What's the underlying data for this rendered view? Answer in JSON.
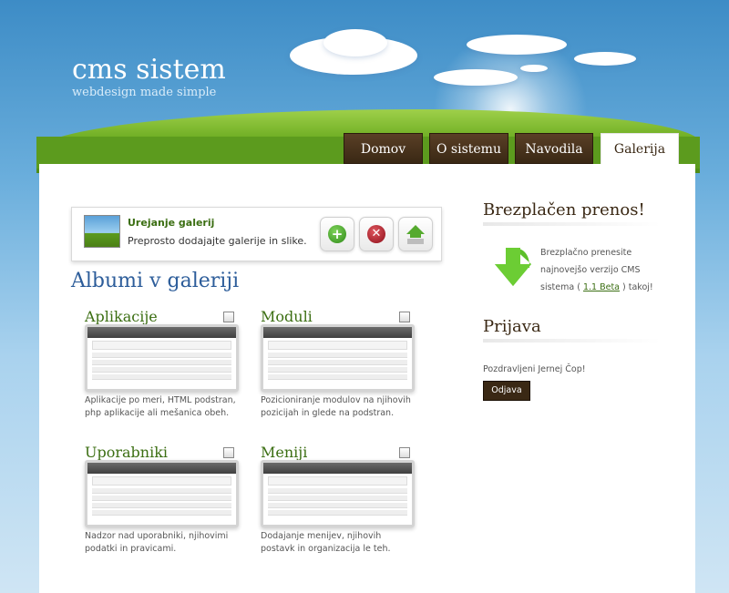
{
  "header": {
    "logo_title": "cms sistem",
    "logo_tagline": "webdesign made simple"
  },
  "nav": {
    "tabs": [
      {
        "label": "Domov",
        "active": false
      },
      {
        "label": "O sistemu",
        "active": false
      },
      {
        "label": "Navodila",
        "active": false
      },
      {
        "label": "Galerija",
        "active": true
      }
    ]
  },
  "infobox": {
    "title": "Urejanje galerij",
    "description": "Preprosto dodajajte galerije in slike."
  },
  "albums": {
    "heading": "Albumi v galeriji",
    "items": [
      {
        "title": "Aplikacije",
        "description": "Aplikacije po meri, HTML podstran, php aplikacije ali mešanica obeh."
      },
      {
        "title": "Moduli",
        "description": "Pozicioniranje modulov na njihovih pozicijah in glede na podstran."
      },
      {
        "title": "Uporabniki",
        "description": "Nadzor nad uporabniki, njihovimi podatki in pravicami."
      },
      {
        "title": "Meniji",
        "description": "Dodajanje menijev, njihovih postavk in organizacija le teh."
      }
    ]
  },
  "sidebar": {
    "download_heading": "Brezplačen prenos!",
    "download_text_before": "Brezplačno prenesite najnovejšo verzijo CMS sistema (",
    "download_link": "1.1 Beta",
    "download_text_after": ") takoj!",
    "login_heading": "Prijava",
    "greeting": "Pozdravljeni Jernej Čop!",
    "logout_label": "Odjava"
  },
  "colors": {
    "accent_green": "#3b6e12",
    "brown": "#3a2814",
    "heading_blue": "#2d5d9a"
  }
}
